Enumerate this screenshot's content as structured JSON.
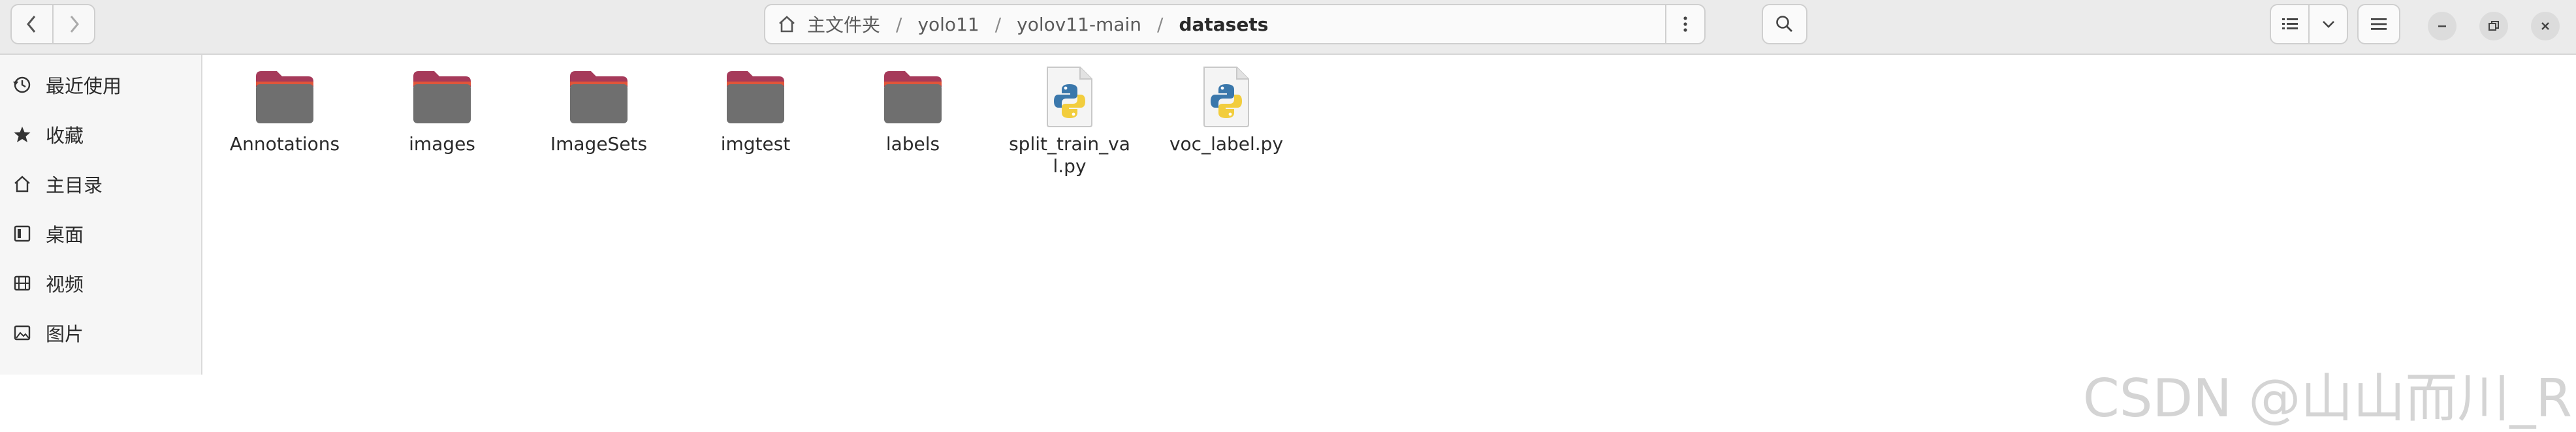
{
  "header": {
    "breadcrumbs": [
      "主文件夹",
      "yolo11",
      "yolov11-main",
      "datasets"
    ],
    "separator": "/"
  },
  "sidebar": {
    "items": [
      {
        "label": "最近使用",
        "icon": "clock-icon"
      },
      {
        "label": "收藏",
        "icon": "star-icon"
      },
      {
        "label": "主目录",
        "icon": "home-icon"
      },
      {
        "label": "桌面",
        "icon": "desktop-icon"
      },
      {
        "label": "视频",
        "icon": "video-icon"
      },
      {
        "label": "图片",
        "icon": "picture-icon"
      }
    ]
  },
  "files": [
    {
      "name": "Annotations",
      "type": "folder"
    },
    {
      "name": "images",
      "type": "folder"
    },
    {
      "name": "ImageSets",
      "type": "folder"
    },
    {
      "name": "imgtest",
      "type": "folder"
    },
    {
      "name": "labels",
      "type": "folder"
    },
    {
      "name": "split_train_val.py",
      "type": "python-file"
    },
    {
      "name": "voc_label.py",
      "type": "python-file"
    }
  ],
  "watermark": "CSDN @山山而川_R",
  "colors": {
    "folder_body": "#6f6f6f",
    "folder_tab": "#a63a5a",
    "folder_accent": "#e0553a"
  }
}
